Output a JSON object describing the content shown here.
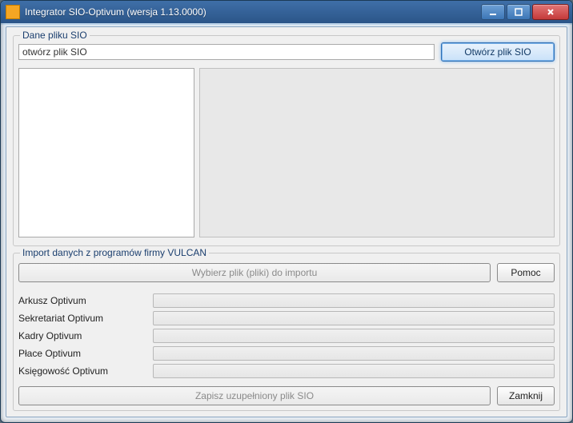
{
  "window": {
    "title": "Integrator SIO-Optivum (wersja 1.13.0000)"
  },
  "group1": {
    "legend": "Dane pliku SIO",
    "path_value": "otwórz plik SIO",
    "open_button": "Otwórz plik SIO"
  },
  "group2": {
    "legend": "Import danych z programów firmy VULCAN",
    "choose_button": "Wybierz plik (pliki) do importu",
    "help_button": "Pomoc",
    "rows": [
      {
        "label": "Arkusz Optivum",
        "value": ""
      },
      {
        "label": "Sekretariat Optivum",
        "value": ""
      },
      {
        "label": "Kadry Optivum",
        "value": ""
      },
      {
        "label": "Płace Optivum",
        "value": ""
      },
      {
        "label": "Księgowość Optivum",
        "value": ""
      }
    ],
    "save_button": "Zapisz uzupełniony plik SIO",
    "close_button": "Zamknij"
  }
}
